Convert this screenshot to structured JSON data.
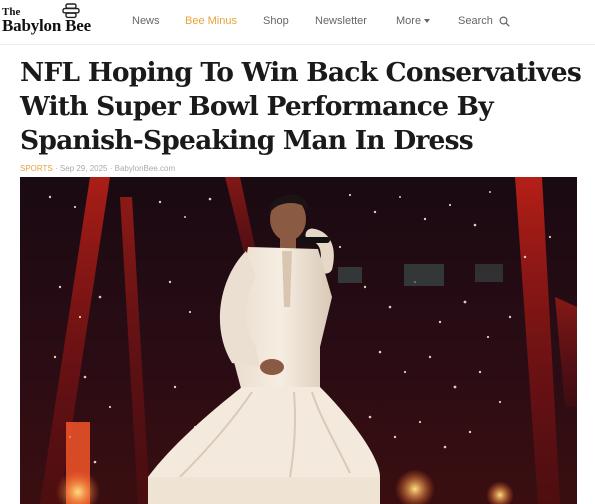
{
  "site": {
    "logo_the": "The",
    "logo_name": "Babylon Bee"
  },
  "nav": {
    "items": [
      {
        "label": "News"
      },
      {
        "label": "Bee Minus"
      },
      {
        "label": "Shop"
      },
      {
        "label": "Newsletter"
      },
      {
        "label": "More"
      },
      {
        "label": "Search"
      }
    ],
    "accent_color": "#e8a23a"
  },
  "article": {
    "headline": "NFL Hoping To Win Back Conservatives With Super Bowl Performance By Spanish-Speaking Man In Dress",
    "category": "SPORTS",
    "date": "Sep 29, 2025",
    "source": "BabylonBee.com",
    "separator": "·"
  },
  "icons": {
    "search": "search-icon",
    "more_caret": "chevron-down-icon",
    "logo": "bee-hive-icon"
  }
}
